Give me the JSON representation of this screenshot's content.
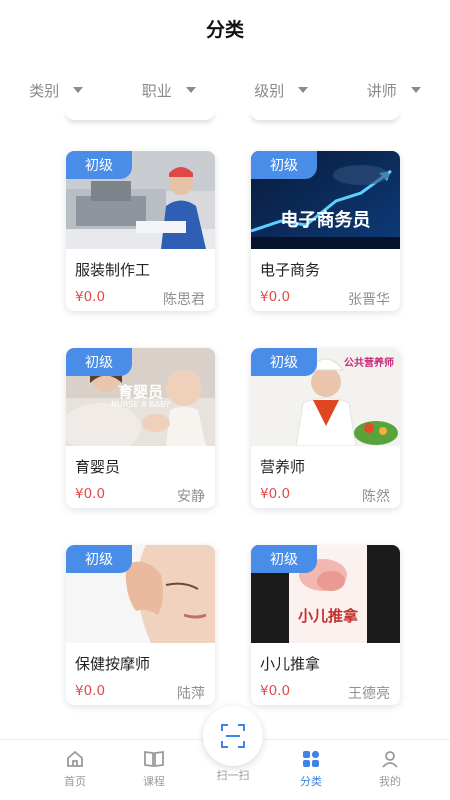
{
  "header": {
    "title": "分类"
  },
  "filters": [
    {
      "label": "类别"
    },
    {
      "label": "职业"
    },
    {
      "label": "级别"
    },
    {
      "label": "讲师"
    }
  ],
  "courses": [
    {
      "badge": "初级",
      "name": "服装制作工",
      "price": "¥0.0",
      "teacher": "陈思君"
    },
    {
      "badge": "初级",
      "name": "电子商务",
      "price": "¥0.0",
      "teacher": "张晋华",
      "image_text": "电子商务员"
    },
    {
      "badge": "初级",
      "name": "育婴员",
      "price": "¥0.0",
      "teacher": "安静",
      "image_text": "育婴员",
      "image_subtext": "NURSE A BABY"
    },
    {
      "badge": "初级",
      "name": "营养师",
      "price": "¥0.0",
      "teacher": "陈然",
      "image_text": "公共营养师"
    },
    {
      "badge": "初级",
      "name": "保健按摩师",
      "price": "¥0.0",
      "teacher": "陆萍"
    },
    {
      "badge": "初级",
      "name": "小儿推拿",
      "price": "¥0.0",
      "teacher": "王德亮",
      "image_text": "小儿推拿"
    }
  ],
  "tabbar": {
    "home": "首页",
    "course": "课程",
    "scan": "扫一扫",
    "category": "分类",
    "mine": "我的"
  },
  "colors": {
    "accent": "#3f83e6",
    "badge": "#4a8de8",
    "price": "#e24a4a"
  }
}
